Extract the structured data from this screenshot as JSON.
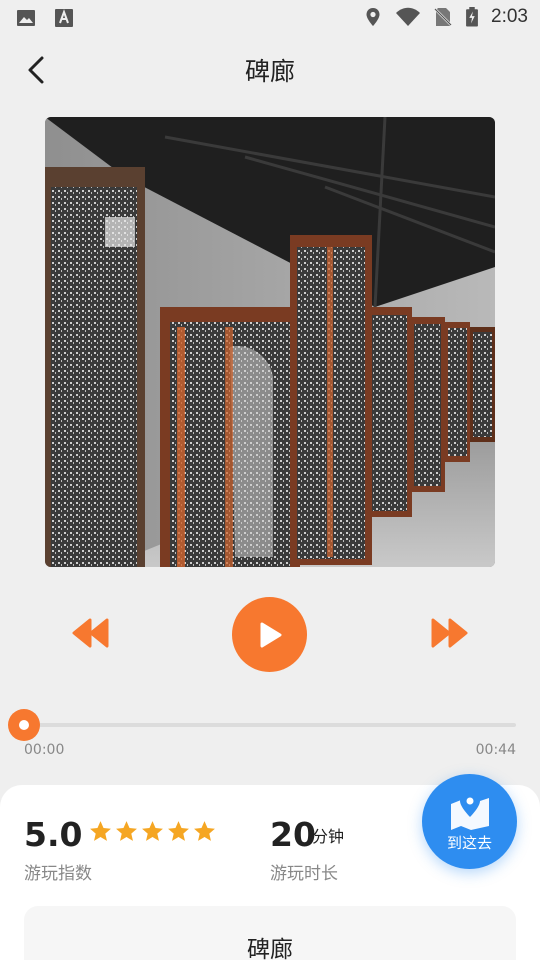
{
  "status_bar": {
    "time": "2:03",
    "icons_left": [
      "gallery-icon",
      "text-a-icon"
    ],
    "icons_right": [
      "location-icon",
      "wifi-icon",
      "no-sim-icon",
      "battery-charging-icon"
    ]
  },
  "header": {
    "title": "碑廊",
    "back_icon": "chevron-left-icon"
  },
  "player": {
    "current_time": "00:00",
    "total_time": "00:44",
    "progress": 0,
    "play_icon": "play-icon",
    "rewind_icon": "rewind-icon",
    "forward_icon": "fast-forward-icon"
  },
  "info": {
    "rating": "5.0",
    "stars": 5,
    "rating_label": "游玩指数",
    "duration_value": "20",
    "duration_unit": "分钟",
    "duration_label": "游玩时长"
  },
  "nav_button": {
    "label": "到这去",
    "icon": "map-pin-icon"
  },
  "spot_card": {
    "title": "碑廊"
  },
  "colors": {
    "accent": "#f7782f",
    "fab": "#2e8df0",
    "star": "#f5a623",
    "background": "#efefef"
  }
}
